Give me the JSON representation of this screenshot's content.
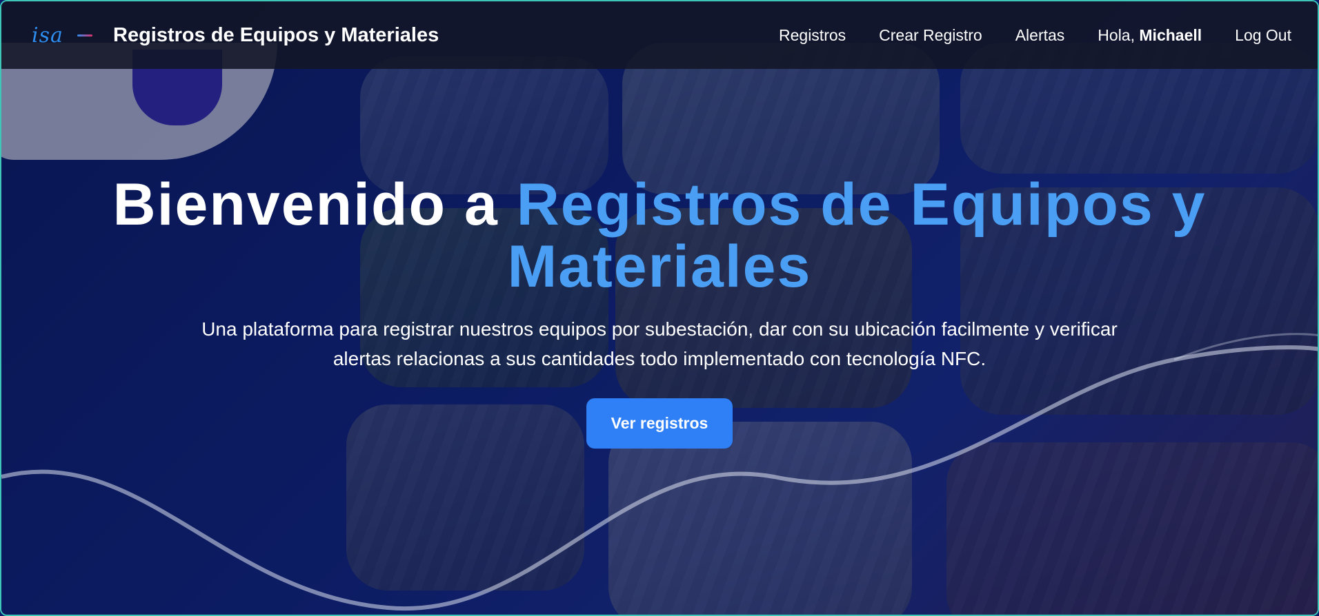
{
  "navbar": {
    "logo_text": "isa",
    "brand": "Registros de Equipos y Materiales",
    "links": {
      "registros": "Registros",
      "crear_registro": "Crear Registro",
      "alertas": "Alertas",
      "logout": "Log Out"
    },
    "greeting_prefix": "Hola, ",
    "user_name": "Michaell"
  },
  "hero": {
    "title_prefix": "Bienvenido a ",
    "title_accent": "Registros de Equipos y Materiales",
    "subtitle": "Una plataforma para registrar nuestros equipos por subestación, dar con su ubicación facilmente y verificar alertas relacionas a sus cantidades todo implementado con tecnología NFC.",
    "cta_label": "Ver registros"
  },
  "colors": {
    "accent": "#4a9ff5",
    "button": "#2f7ff6",
    "navbar_bg": "#12162699"
  },
  "icons": {
    "logo": "isa-logo-icon"
  }
}
